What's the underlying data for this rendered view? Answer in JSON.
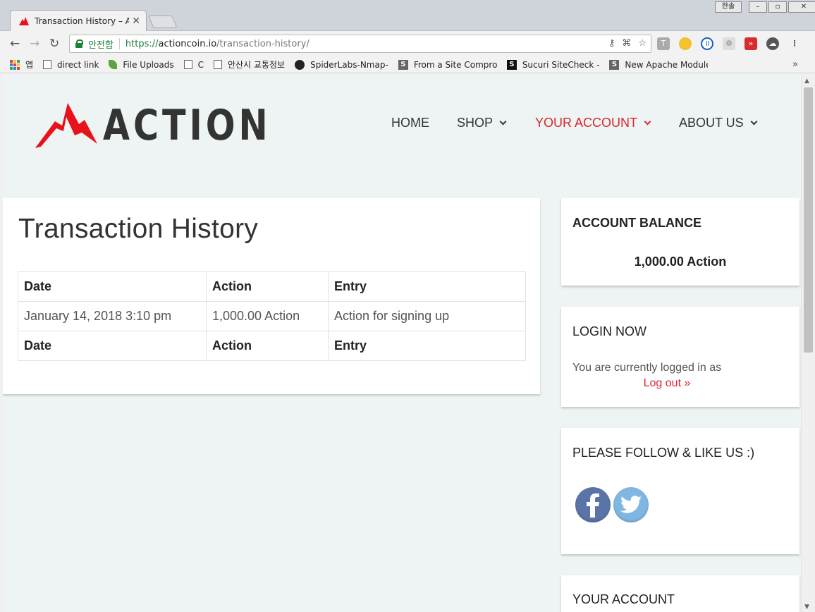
{
  "browser": {
    "tab_title": "Transaction History – A",
    "ime_label": "한솔",
    "secure_label": "안전함",
    "url_scheme": "https://",
    "url_host": "actioncoin.io",
    "url_path": "/transaction-history/",
    "bookmarks": [
      {
        "label": "앱"
      },
      {
        "label": "direct link"
      },
      {
        "label": "File Uploads"
      },
      {
        "label": "C"
      },
      {
        "label": "안산시 교통정보"
      },
      {
        "label": "SpiderLabs-Nmap-"
      },
      {
        "label": "From a Site Compro"
      },
      {
        "label": "Sucuri SiteCheck -"
      },
      {
        "label": "New Apache Module"
      }
    ],
    "more_bookmarks": "»"
  },
  "site": {
    "logo_text": "ACTION",
    "brand_color": "#d9272e",
    "nav": [
      {
        "label": "HOME"
      },
      {
        "label": "SHOP"
      },
      {
        "label": "YOUR ACCOUNT"
      },
      {
        "label": "ABOUT US"
      }
    ]
  },
  "main": {
    "title": "Transaction History",
    "table": {
      "headers": [
        "Date",
        "Action",
        "Entry"
      ],
      "rows": [
        [
          "January 14, 2018 3:10 pm",
          "1,000.00 Action",
          "Action for signing up"
        ]
      ],
      "footers": [
        "Date",
        "Action",
        "Entry"
      ]
    }
  },
  "sidebar": {
    "balance": {
      "title": "ACCOUNT BALANCE",
      "value": "1,000.00 Action"
    },
    "login": {
      "title": "LOGIN NOW",
      "text": "You are currently logged in as",
      "logout": "Log out »"
    },
    "follow": {
      "title": "PLEASE FOLLOW & LIKE US :)",
      "icons": [
        "facebook-icon",
        "twitter-icon"
      ]
    },
    "account": {
      "title": "YOUR ACCOUNT"
    }
  }
}
